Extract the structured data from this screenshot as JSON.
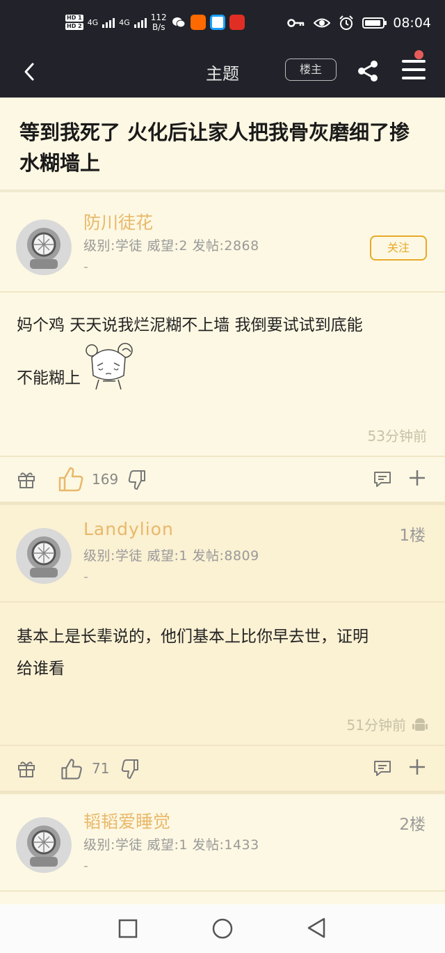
{
  "status_bar": {
    "hd1": "HD 1",
    "hd2": "HD 2",
    "net1": "4G",
    "net2": "4G",
    "speed_value": "112",
    "speed_unit": "B/s",
    "time": "08:04",
    "apps": [
      {
        "name": "wechat-icon",
        "color": "#ffffff"
      },
      {
        "name": "taobao-icon",
        "color": "#ff6a00"
      },
      {
        "name": "app-icon",
        "color": "#1aa1ff"
      },
      {
        "name": "pinduoduo-icon",
        "color": "#e02e24"
      }
    ]
  },
  "nav": {
    "title": "主题",
    "louzhu_label": "楼主"
  },
  "thread": {
    "title": "等到我死了 火化后让家人把我骨灰磨细了掺水糊墙上"
  },
  "posts": [
    {
      "username": "防川徒花",
      "meta": "级别:学徒  威望:2  发帖:2868",
      "dash": "-",
      "follow_label": "关注",
      "content_line1": "妈个鸡 天天说我烂泥糊不上墙 我倒要试试到底能",
      "content_line2": "不能糊上",
      "time": "53分钟前",
      "likes": "169"
    },
    {
      "username": "Landylion",
      "meta": "级别:学徒  威望:1  发帖:8809",
      "dash": "-",
      "floor": "1楼",
      "content_line1": "基本上是长辈说的，他们基本上比你早去世，证明",
      "content_line2": "给谁看",
      "time": "51分钟前",
      "likes": "71"
    },
    {
      "username": "韬韬爱睡觉",
      "meta": "级别:学徒  威望:1  发帖:1433",
      "dash": "-",
      "floor": "2楼"
    }
  ],
  "colors": {
    "accent": "#e8a928",
    "username": "#e8b86a",
    "background": "#fdf8e3",
    "header": "#22232a"
  }
}
